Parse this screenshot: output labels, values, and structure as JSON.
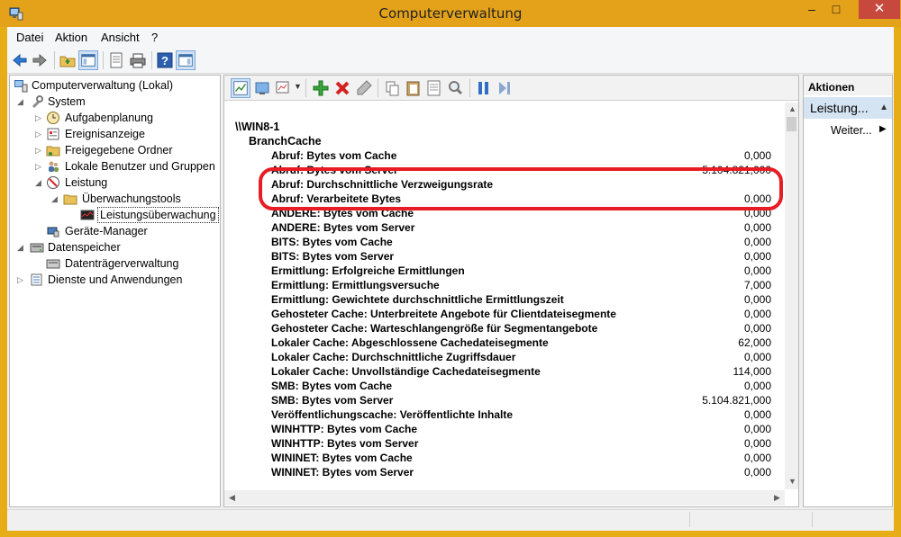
{
  "window": {
    "title": "Computerverwaltung",
    "min_glyph": "–",
    "max_glyph": "□",
    "close_glyph": "✕"
  },
  "menu": {
    "items": [
      "Datei",
      "Aktion",
      "Ansicht",
      "?"
    ]
  },
  "toolbar": {
    "icons": [
      "back-icon",
      "forward-icon",
      "up-folder-icon",
      "show-hide-tree-icon",
      "properties-icon",
      "print-icon",
      "help-icon",
      "show-hide-action-pane-icon"
    ]
  },
  "tree": {
    "items": [
      {
        "label": "Computerverwaltung (Lokal)",
        "icon": "computer-management-icon",
        "expander": ""
      },
      {
        "label": "System",
        "icon": "system-tools-icon",
        "expander": "◢"
      },
      {
        "label": "Aufgabenplanung",
        "icon": "clock-icon",
        "expander": "▷"
      },
      {
        "label": "Ereignisanzeige",
        "icon": "event-viewer-icon",
        "expander": "▷"
      },
      {
        "label": "Freigegebene Ordner",
        "icon": "shared-folder-icon",
        "expander": "▷"
      },
      {
        "label": "Lokale Benutzer und Gruppen",
        "icon": "users-icon",
        "expander": "▷"
      },
      {
        "label": "Leistung",
        "icon": "performance-icon",
        "expander": "◢"
      },
      {
        "label": "Überwachungstools",
        "icon": "folder-icon",
        "expander": "◢"
      },
      {
        "label": "Leistungsüberwachung",
        "icon": "monitor-icon",
        "expander": ""
      },
      {
        "label": "Geräte-Manager",
        "icon": "device-manager-icon",
        "expander": ""
      },
      {
        "label": "Datenspeicher",
        "icon": "storage-icon",
        "expander": "◢"
      },
      {
        "label": "Datenträgerverwaltung",
        "icon": "disk-icon",
        "expander": ""
      },
      {
        "label": "Dienste und Anwendungen",
        "icon": "services-icon",
        "expander": "▷"
      }
    ]
  },
  "center_toolbar": {
    "icons": [
      "change-graph-type-icon",
      "view-current-activity-icon",
      "change-view-icon",
      "add-icon",
      "delete-icon",
      "highlight-icon",
      "copy-properties-icon",
      "paste-counter-list-icon",
      "properties-icon",
      "zoom-icon",
      "freeze-display-icon",
      "update-data-icon"
    ]
  },
  "report": {
    "machine": "\\\\WIN8-1",
    "object": "BranchCache",
    "rows": [
      {
        "name": "Abruf: Bytes vom Cache",
        "value": "0,000"
      },
      {
        "name": "Abruf: Bytes vom Server",
        "value": "5.104.821,000"
      },
      {
        "name": "Abruf: Durchschnittliche Verzweigungsrate",
        "value": ""
      },
      {
        "name": "Abruf: Verarbeitete Bytes",
        "value": "0,000"
      },
      {
        "name": "ANDERE: Bytes vom Cache",
        "value": "0,000"
      },
      {
        "name": "ANDERE: Bytes vom Server",
        "value": "0,000"
      },
      {
        "name": "BITS: Bytes vom Cache",
        "value": "0,000"
      },
      {
        "name": "BITS: Bytes vom Server",
        "value": "0,000"
      },
      {
        "name": "Ermittlung: Erfolgreiche Ermittlungen",
        "value": "0,000"
      },
      {
        "name": "Ermittlung: Ermittlungsversuche",
        "value": "7,000"
      },
      {
        "name": "Ermittlung: Gewichtete durchschnittliche Ermittlungszeit",
        "value": "0,000"
      },
      {
        "name": "Gehosteter Cache: Unterbreitete Angebote für Clientdateisegmente",
        "value": "0,000"
      },
      {
        "name": "Gehosteter Cache: Warteschlangengröße für Segmentangebote",
        "value": "0,000"
      },
      {
        "name": "Lokaler Cache: Abgeschlossene Cachedateisegmente",
        "value": "62,000"
      },
      {
        "name": "Lokaler Cache: Durchschnittliche Zugriffsdauer",
        "value": "0,000"
      },
      {
        "name": "Lokaler Cache: Unvollständige Cachedateisegmente",
        "value": "114,000"
      },
      {
        "name": "SMB: Bytes vom Cache",
        "value": "0,000"
      },
      {
        "name": "SMB: Bytes vom Server",
        "value": "5.104.821,000"
      },
      {
        "name": "Veröffentlichungscache: Veröffentlichte Inhalte",
        "value": "0,000"
      },
      {
        "name": "WINHTTP: Bytes vom Cache",
        "value": "0,000"
      },
      {
        "name": "WINHTTP: Bytes vom Server",
        "value": "0,000"
      },
      {
        "name": "WININET: Bytes vom Cache",
        "value": "0,000"
      },
      {
        "name": "WININET: Bytes vom Server",
        "value": "0,000"
      }
    ],
    "highlight_color": "#e81c24"
  },
  "actions": {
    "header": "Aktionen",
    "group": "Leistung...",
    "item": "Weiter..."
  }
}
